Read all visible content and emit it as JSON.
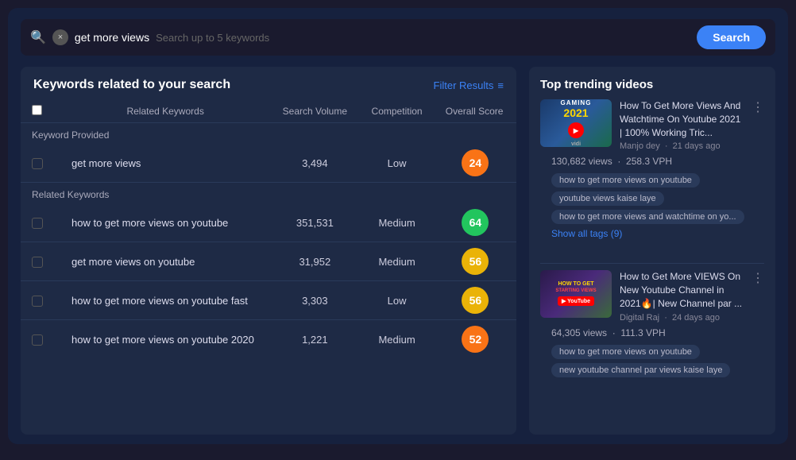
{
  "search": {
    "query": "get more views",
    "placeholder": "Search up to 5 keywords",
    "button_label": "Search",
    "close_label": "×"
  },
  "left_panel": {
    "title": "Keywords related to your search",
    "filter_label": "Filter Results",
    "table": {
      "headers": [
        "Related Keywords",
        "Search Volume",
        "Competition",
        "Overall Score"
      ],
      "sections": [
        {
          "label": "Keyword Provided",
          "rows": [
            {
              "keyword": "get more views",
              "volume": "3,494",
              "competition": "Low",
              "score": "24",
              "score_color": "orange"
            }
          ]
        },
        {
          "label": "Related Keywords",
          "rows": [
            {
              "keyword": "how to get more views on youtube",
              "volume": "351,531",
              "competition": "Medium",
              "score": "64",
              "score_color": "green"
            },
            {
              "keyword": "get more views on youtube",
              "volume": "31,952",
              "competition": "Medium",
              "score": "56",
              "score_color": "yellow"
            },
            {
              "keyword": "how to get more views on youtube fast",
              "volume": "3,303",
              "competition": "Low",
              "score": "56",
              "score_color": "yellow"
            },
            {
              "keyword": "how to get more views on youtube 2020",
              "volume": "1,221",
              "competition": "Medium",
              "score": "52",
              "score_color": "orange"
            }
          ]
        }
      ]
    }
  },
  "right_panel": {
    "title": "Top trending videos",
    "videos": [
      {
        "title": "How To Get More Views And Watchtime On Youtube 2021 | 100% Working Tric...",
        "channel": "Manjo dey",
        "posted": "21 days ago",
        "views": "130,682 views",
        "vph": "258.3 VPH",
        "thumb_type": "gaming",
        "thumb_label": "GAMING",
        "thumb_year": "2021",
        "tags": [
          "how to get more views on youtube",
          "youtube views kaise laye",
          "how to get more views and watchtime on yo..."
        ],
        "show_all_tags": "Show all tags (9)"
      },
      {
        "title": "How to Get More VIEWS On New Youtube Channel in 2021🔥| New Channel par ...",
        "channel": "Digital Raj",
        "posted": "24 days ago",
        "views": "64,305 views",
        "vph": "111.3 VPH",
        "thumb_type": "how-to",
        "thumb_label": "HOW TO GET STARTING VIEWS",
        "tags": [
          "how to get more views on youtube",
          "new youtube channel par views kaise laye"
        ],
        "show_all_tags": ""
      }
    ]
  }
}
